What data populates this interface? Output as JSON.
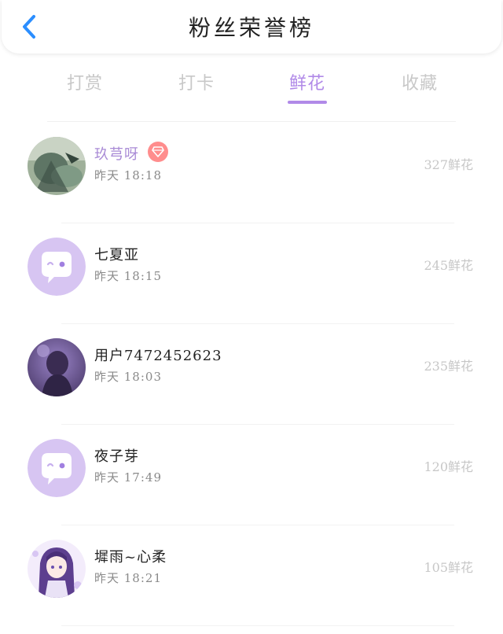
{
  "header": {
    "title": "粉丝荣誉榜",
    "back_icon": "chevron-left-icon",
    "accent": "#2b8eff"
  },
  "tabs": [
    {
      "label": "打赏"
    },
    {
      "label": "打卡"
    },
    {
      "label": "鲜花",
      "active": true
    },
    {
      "label": "收藏"
    }
  ],
  "colors": {
    "active_tab": "#b18ae8",
    "vip_name": "#a98bd6",
    "badge": "#ff8d8d",
    "count": "#c7c7c7"
  },
  "fans": [
    {
      "name": "玖芎呀",
      "time": "昨天 18:18",
      "count": "327鲜花",
      "vip": true,
      "badge_icon": "diamond-icon",
      "avatar": "photo-avatar-green"
    },
    {
      "name": "七夏亚",
      "time": "昨天 18:15",
      "count": "245鲜花",
      "vip": false,
      "avatar": "default-chat-avatar"
    },
    {
      "name": "用户7472452623",
      "time": "昨天 18:03",
      "count": "235鲜花",
      "vip": false,
      "avatar": "photo-avatar-purple"
    },
    {
      "name": "夜子芽",
      "time": "昨天 17:49",
      "count": "120鲜花",
      "vip": false,
      "avatar": "default-chat-avatar"
    },
    {
      "name": "墀雨~心柔",
      "time": "昨天 18:21",
      "count": "105鲜花",
      "vip": false,
      "avatar": "anime-avatar"
    }
  ]
}
